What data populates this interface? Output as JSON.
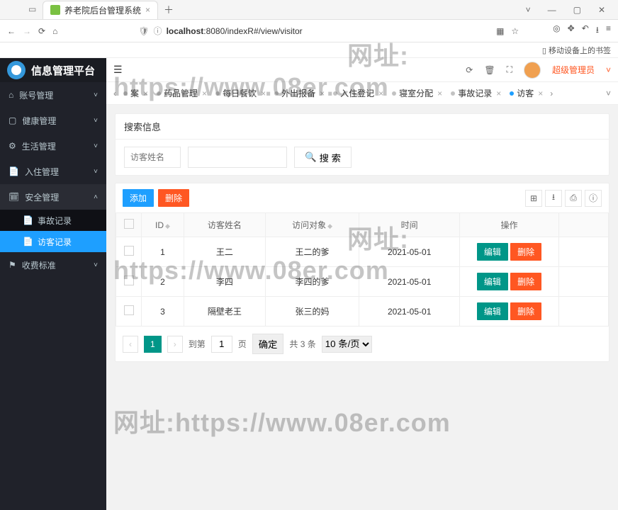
{
  "browser": {
    "tab_title": "养老院后台管理系统",
    "url_host": "localhost",
    "url_rest": ":8080/indexR#/view/visitor",
    "bookmark": "移动设备上的书签"
  },
  "app": {
    "title": "信息管理平台",
    "role": "超级管理员"
  },
  "sidebar": {
    "items": [
      {
        "label": "账号管理",
        "icon": "home",
        "expanded": false
      },
      {
        "label": "健康管理",
        "icon": "panel",
        "expanded": false
      },
      {
        "label": "生活管理",
        "icon": "link",
        "expanded": false
      },
      {
        "label": "入住管理",
        "icon": "doc",
        "expanded": false
      },
      {
        "label": "安全管理",
        "icon": "calendar",
        "expanded": true,
        "children": [
          {
            "label": "事故记录",
            "active": false
          },
          {
            "label": "访客记录",
            "active": true
          }
        ]
      },
      {
        "label": "收费标准",
        "icon": "flag",
        "expanded": false
      }
    ]
  },
  "tabs": {
    "items": [
      {
        "label": "案",
        "partial": true
      },
      {
        "label": "药品管理"
      },
      {
        "label": "每日餐饮"
      },
      {
        "label": "外出报备"
      },
      {
        "label": "入住登记"
      },
      {
        "label": "寝室分配"
      },
      {
        "label": "事故记录"
      },
      {
        "label": "访客",
        "active": true,
        "partial": true
      }
    ]
  },
  "search": {
    "panel_title": "搜索信息",
    "placeholder": "访客姓名",
    "btn": "搜 索"
  },
  "toolbar": {
    "add": "添加",
    "delete": "删除"
  },
  "table": {
    "headers": {
      "id": "ID",
      "name": "访客姓名",
      "target": "访问对象",
      "time": "时间",
      "ops": "操作"
    },
    "ops": {
      "edit": "编辑",
      "del": "删除"
    },
    "rows": [
      {
        "id": "1",
        "name": "王二",
        "target": "王二的爹",
        "time": "2021-05-01"
      },
      {
        "id": "2",
        "name": "李四",
        "target": "李四的爹",
        "time": "2021-05-01"
      },
      {
        "id": "3",
        "name": "隔壁老王",
        "target": "张三的妈",
        "time": "2021-05-01"
      }
    ]
  },
  "pager": {
    "page": "1",
    "to": "到第",
    "page_unit": "页",
    "confirm": "确定",
    "total": "共 3 条",
    "per": "10 条/页"
  },
  "watermark": {
    "line1": "网址:",
    "line2": "https://www.08er.com"
  }
}
